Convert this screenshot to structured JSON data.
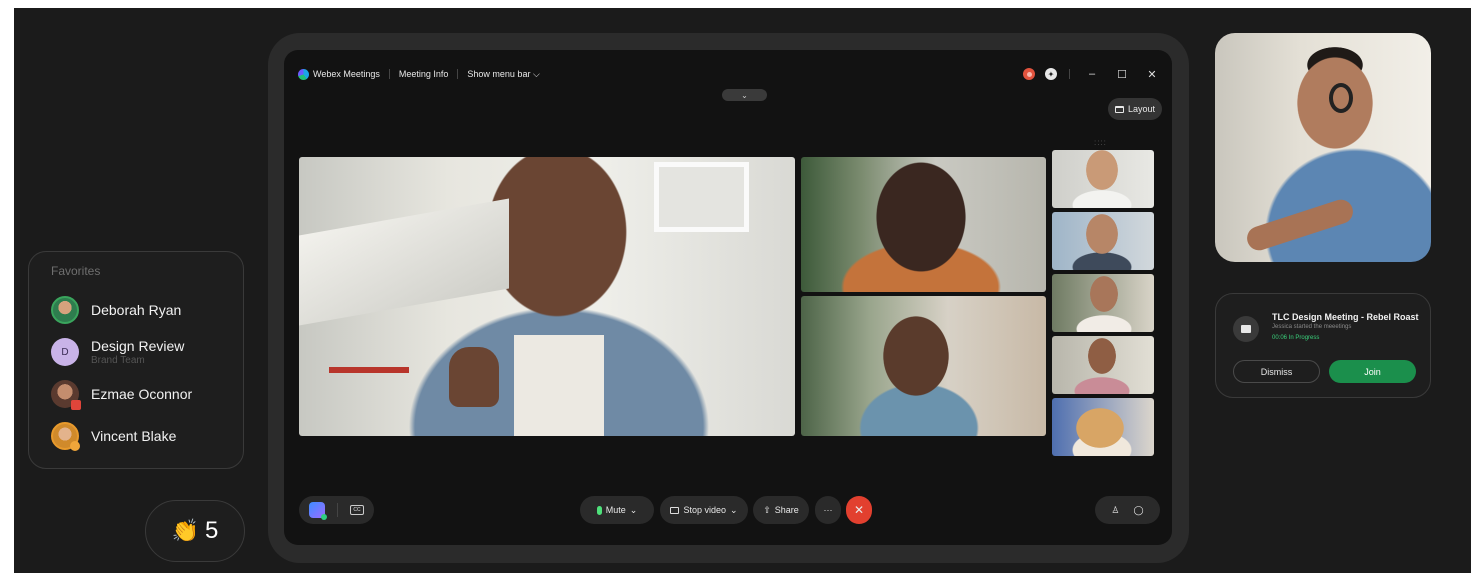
{
  "favorites": {
    "title": "Favorites",
    "items": [
      {
        "name": "Deborah Ryan",
        "sub": ""
      },
      {
        "name": "Design Review",
        "sub": "Brand Team",
        "initial": "D"
      },
      {
        "name": "Ezmae Oconnor",
        "sub": ""
      },
      {
        "name": "Vincent Blake",
        "sub": ""
      }
    ]
  },
  "reactions": {
    "icon": "clapping-hands-icon",
    "emoji": "👏",
    "count": "5"
  },
  "meeting": {
    "app_name": "Webex Meetings",
    "meeting_info": "Meeting Info",
    "show_menu_bar": "Show menu bar ⌵",
    "pull_tab": "⌄",
    "layout_label": "Layout",
    "grip": "::::",
    "window": {
      "minimize": "–",
      "maximize": "☐",
      "close": "✕"
    }
  },
  "controls": {
    "mute_label": "Mute",
    "mute_chevron": "⌄",
    "stop_video_label": "Stop video",
    "stop_video_chevron": "⌄",
    "share_label": "Share",
    "share_icon": "⇧",
    "more_label": "···",
    "end_label": "✕",
    "participants_icon": "♙",
    "chat_icon": "◯",
    "cc_label": "CC"
  },
  "notification": {
    "title": "TLC Design Meeting - Rebel Roast",
    "subtitle": "Jessica started the meeetings",
    "status": "00:06  In Progress",
    "dismiss": "Dismiss",
    "join": "Join"
  },
  "colors": {
    "accent_green": "#1b8f4c",
    "end_red": "#e2402f",
    "status_green": "#3ad07b"
  }
}
